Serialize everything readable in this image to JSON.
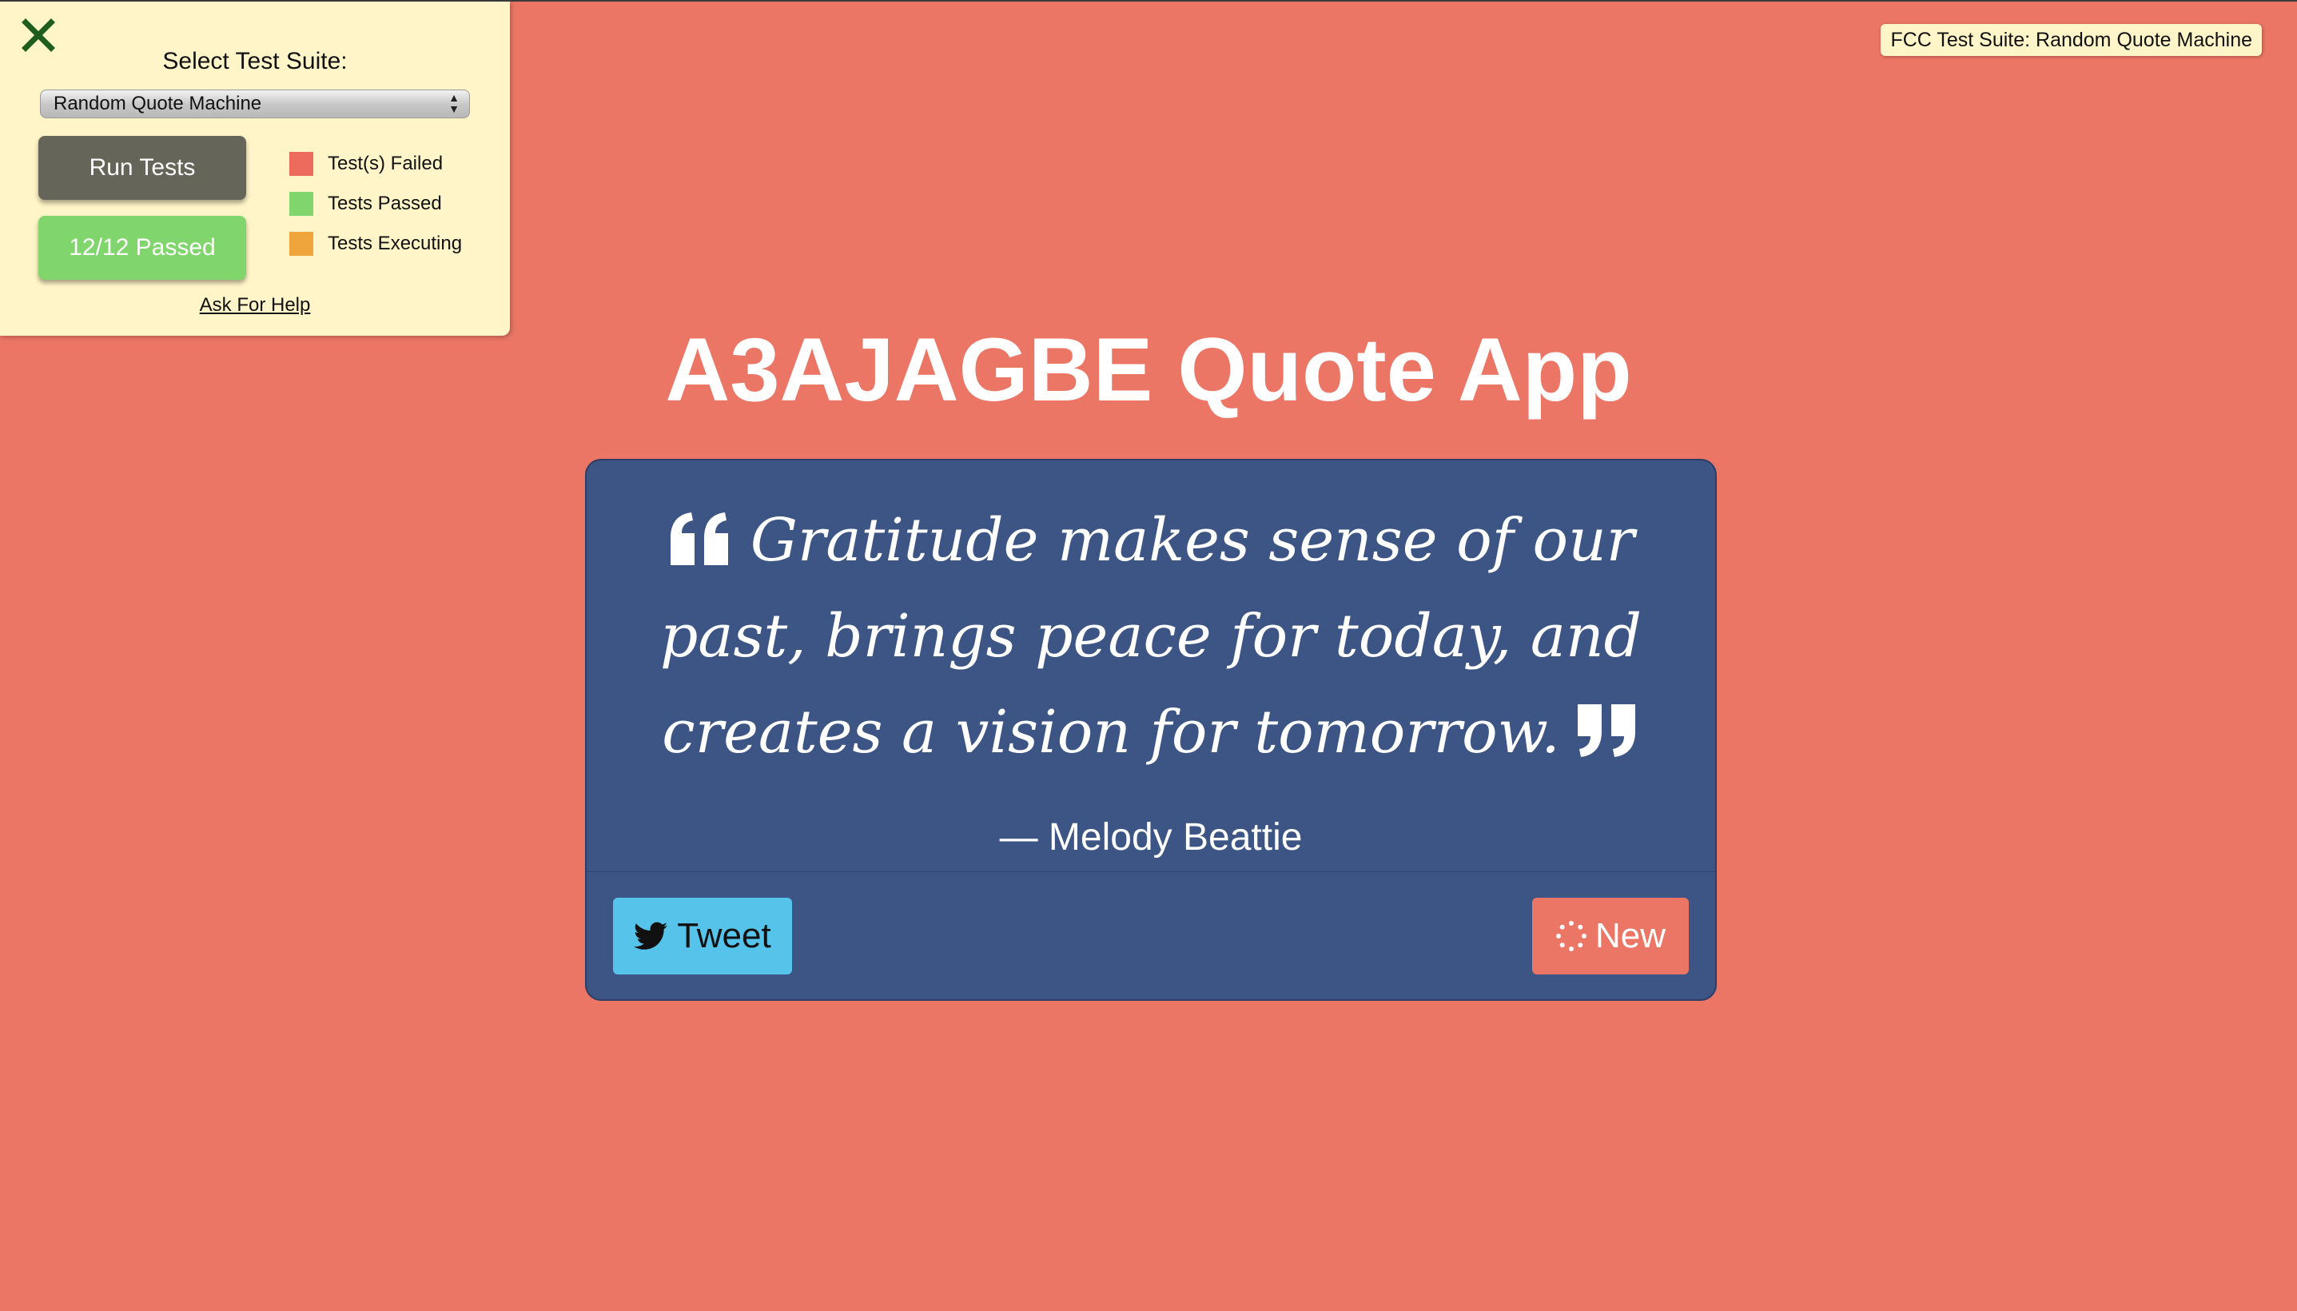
{
  "fcc_panel": {
    "close_icon": "close-x-icon",
    "title": "Select Test Suite:",
    "selected_suite": "Random Quote Machine",
    "run_label": "Run Tests",
    "passed_label": "12/12 Passed",
    "passed_fraction": 1.0,
    "legend": [
      {
        "label": "Test(s) Failed",
        "color": "#ec6b5c"
      },
      {
        "label": "Tests Passed",
        "color": "#80d66d"
      },
      {
        "label": "Tests Executing",
        "color": "#f0a53c"
      }
    ],
    "help_label": "Ask For Help"
  },
  "badge": "FCC Test Suite: Random Quote Machine",
  "app": {
    "title": "A3AJAGBE Quote App",
    "quote": "Gratitude makes sense of our past, brings peace for today, and creates a vision for tomorrow.",
    "author": "— Melody Beattie",
    "tweet_label": "Tweet",
    "tweet_icon": "twitter-icon",
    "new_label": "New",
    "new_icon": "spinner-icon"
  },
  "colors": {
    "background": "#ec7665",
    "quote_box": "#3c5585",
    "tweet_button": "#55c3ea",
    "panel": "#fff5c8"
  }
}
